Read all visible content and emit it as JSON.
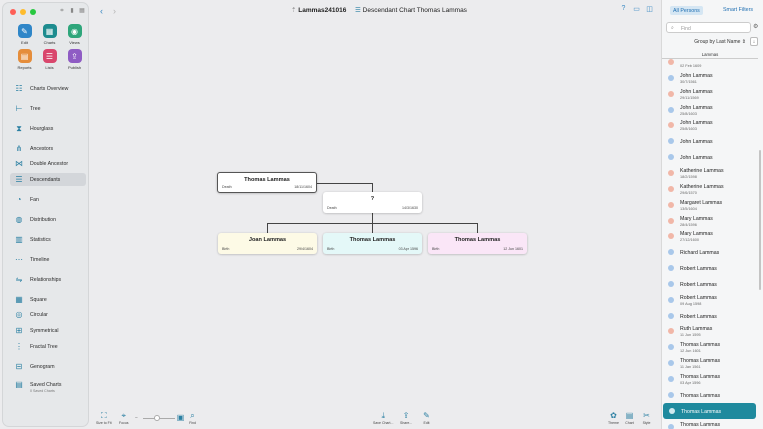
{
  "window": {
    "db_title": "Lammas241016",
    "chart_title": "Descendant Chart Thomas Lammas"
  },
  "tools": [
    {
      "label": "Edit",
      "icon": "pencil-icon",
      "color": "#2f86c8"
    },
    {
      "label": "Charts",
      "icon": "charts-icon",
      "color": "#1d8c8f"
    },
    {
      "label": "Views",
      "icon": "eye-icon",
      "color": "#2ea67b"
    },
    {
      "label": "Reports",
      "icon": "reports-icon",
      "color": "#e58d3b"
    },
    {
      "label": "Lists",
      "icon": "lists-icon",
      "color": "#d9476d"
    },
    {
      "label": "Publish",
      "icon": "publish-icon",
      "color": "#8f5cc4"
    }
  ],
  "nav": [
    {
      "label": "Charts Overview",
      "icon": "charts-overview-icon"
    },
    {
      "label": "Tree",
      "icon": "tree-icon"
    },
    {
      "label": "Hourglass",
      "icon": "hourglass-icon"
    },
    {
      "label": "Ancestors",
      "icon": "ancestors-icon"
    },
    {
      "label": "Double Ancestor",
      "icon": "double-ancestor-icon"
    },
    {
      "label": "Descendants",
      "icon": "descendants-icon"
    },
    {
      "label": "Fan",
      "icon": "fan-icon"
    },
    {
      "label": "Distribution",
      "icon": "distribution-icon"
    },
    {
      "label": "Statistics",
      "icon": "statistics-icon"
    },
    {
      "label": "Timeline",
      "icon": "timeline-icon"
    },
    {
      "label": "Relationships",
      "icon": "relationships-icon"
    },
    {
      "label": "Square",
      "icon": "square-icon"
    },
    {
      "label": "Circular",
      "icon": "circular-icon"
    },
    {
      "label": "Symmetrical",
      "icon": "symmetrical-icon"
    },
    {
      "label": "Fractal Tree",
      "icon": "fractal-tree-icon"
    },
    {
      "label": "Genogram",
      "icon": "genogram-icon"
    },
    {
      "label": "Saved Charts",
      "icon": "saved-charts-icon",
      "sub": "0 Saved Charts"
    }
  ],
  "chart": {
    "root": {
      "name": "Thomas Lammas",
      "event": "Death",
      "date": "18/11/1604"
    },
    "spouse": {
      "name": "?",
      "event": "Death",
      "date": "14/3/1630"
    },
    "children": [
      {
        "name": "Joan Lammas",
        "event": "Birth",
        "date": "29/4/1604",
        "color": "#fdfae6"
      },
      {
        "name": "Thomas Lammas",
        "event": "Birth",
        "date": "03 Apr 1596",
        "color": "#e4f8f8"
      },
      {
        "name": "Thomas Lammas",
        "event": "Birth",
        "date": "12 Jun 1601",
        "color": "#fae6f7"
      }
    ]
  },
  "bottombar": {
    "size_to_fit": "Size to Fit",
    "focus": "Focus",
    "find": "Find",
    "save_chart": "Save Chart...",
    "share": "Share...",
    "edit": "Edit",
    "theme": "Theme",
    "chart": "Chart",
    "style": "Style"
  },
  "panel": {
    "all_persons": "All Persons",
    "smart_filters": "Smart Filters",
    "search_placeholder": "Find",
    "group_by": "Group by Last Name",
    "section": "Lammas",
    "persons": [
      {
        "name": "",
        "date": "02 Feb 1609",
        "sex": "f"
      },
      {
        "name": "John Lammas",
        "date": "30/7/1561",
        "sex": "m"
      },
      {
        "name": "John Lammas",
        "date": "29/11/1569",
        "sex": "f"
      },
      {
        "name": "John Lammas",
        "date": "25/8/1603",
        "sex": "m"
      },
      {
        "name": "John Lammas",
        "date": "25/8/1603",
        "sex": "f"
      },
      {
        "name": "John Lammas",
        "date": "",
        "sex": "m"
      },
      {
        "name": "John Lammas",
        "date": "",
        "sex": "m"
      },
      {
        "name": "Katherine Lammas",
        "date": "18/2/1598",
        "sex": "f"
      },
      {
        "name": "Katherine Lammas",
        "date": "29/6/1570",
        "sex": "f"
      },
      {
        "name": "Margaret Lammas",
        "date": "13/5/1604",
        "sex": "f"
      },
      {
        "name": "Mary Lammas",
        "date": "28/4/1596",
        "sex": "f"
      },
      {
        "name": "Mary Lammas",
        "date": "27/12/1600",
        "sex": "f"
      },
      {
        "name": "Richard Lammas",
        "date": "",
        "sex": "m"
      },
      {
        "name": "Robert Lammas",
        "date": "",
        "sex": "m"
      },
      {
        "name": "Robert Lammas",
        "date": "",
        "sex": "m"
      },
      {
        "name": "Robert Lammas",
        "date": "09 Aug 1598",
        "sex": "m"
      },
      {
        "name": "Robert Lammas",
        "date": "",
        "sex": "m"
      },
      {
        "name": "Ruth Lammas",
        "date": "11 Jun 1595",
        "sex": "f"
      },
      {
        "name": "Thomas Lammas",
        "date": "12 Jun 1601",
        "sex": "m"
      },
      {
        "name": "Thomas Lammas",
        "date": "11 Jan 1561",
        "sex": "m"
      },
      {
        "name": "Thomas Lammas",
        "date": "03 Apr 1596",
        "sex": "m"
      },
      {
        "name": "Thomas Lammas",
        "date": "",
        "sex": "m"
      },
      {
        "name": "Thomas Lammas",
        "date": "",
        "sex": "m",
        "selected": true
      },
      {
        "name": "Thomas Lammas",
        "date": "14/2/1597",
        "sex": "m"
      },
      {
        "name": "Thos Lammas",
        "date": "",
        "sex": "m"
      }
    ]
  }
}
